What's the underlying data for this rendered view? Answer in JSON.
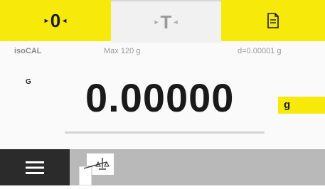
{
  "keys": {
    "zero": {
      "label": "0",
      "icon": "zero-arrows-icon"
    },
    "tare": {
      "label": "T",
      "icon": "tare-arrows-icon"
    },
    "print": {
      "icon": "document-icon"
    }
  },
  "balance": {
    "name": "isoCAL",
    "max": "Max 120 g",
    "readability": "d=0.00001 g"
  },
  "weighing": {
    "net_gross": "G",
    "value": "0.00000",
    "unit": "g",
    "capacity_used_fraction": 0.0
  },
  "bottom": {
    "menu_icon": "hamburger-menu-icon",
    "app_icon": "weighing-app-icon"
  },
  "colors": {
    "accent": "#f7ea0a",
    "dark": "#2b2b2b",
    "bottom_bar": "#b9b9b9"
  }
}
